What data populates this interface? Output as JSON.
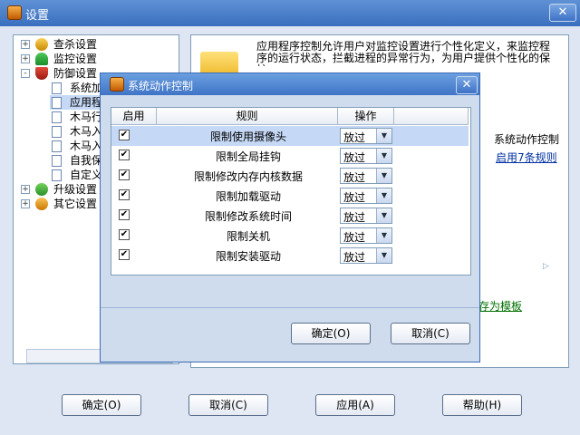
{
  "main": {
    "title": "设置",
    "close_label": "✕",
    "description": "应用程序控制允许用户对监控设置进行个性化定义，来监控程序的运行状态，拦截进程的异常行为，为用户提供个性化的保护。",
    "table_col_header": "系统动作控制",
    "table_cell": "启用7条规则",
    "template_link": "存为模板",
    "buttons": {
      "ok": "确定(O)",
      "cancel": "取消(C)",
      "apply": "应用(A)",
      "help": "帮助(H)"
    }
  },
  "tree": {
    "items": [
      {
        "label": "查杀设置",
        "expander": "+",
        "icon": "scan-icon"
      },
      {
        "label": "监控设置",
        "expander": "+",
        "icon": "umbrella-icon"
      },
      {
        "label": "防御设置",
        "expander": "-",
        "icon": "shield-icon"
      },
      {
        "label": "系统加",
        "icon": "page-icon"
      },
      {
        "label": "应用程",
        "icon": "page-icon",
        "selected": true
      },
      {
        "label": "木马行",
        "icon": "page-icon"
      },
      {
        "label": "木马入",
        "icon": "page-icon"
      },
      {
        "label": "木马入",
        "icon": "page-icon"
      },
      {
        "label": "自我保",
        "icon": "page-icon"
      },
      {
        "label": "自定义",
        "icon": "page-icon"
      },
      {
        "label": "升级设置",
        "expander": "+",
        "icon": "update-icon"
      },
      {
        "label": "其它设置",
        "expander": "+",
        "icon": "gear-icon"
      }
    ]
  },
  "dialog": {
    "title": "系统动作控制",
    "close_label": "✕",
    "headers": {
      "enable": "启用",
      "rule": "规则",
      "action": "操作"
    },
    "rows": [
      {
        "enabled": true,
        "rule": "限制使用摄像头",
        "action": "放过"
      },
      {
        "enabled": true,
        "rule": "限制全局挂钩",
        "action": "放过"
      },
      {
        "enabled": true,
        "rule": "限制修改内存内核数据",
        "action": "放过"
      },
      {
        "enabled": true,
        "rule": "限制加载驱动",
        "action": "放过"
      },
      {
        "enabled": true,
        "rule": "限制修改系统时间",
        "action": "放过"
      },
      {
        "enabled": true,
        "rule": "限制关机",
        "action": "放过"
      },
      {
        "enabled": true,
        "rule": "限制安装驱动",
        "action": "放过"
      }
    ],
    "ok": "确定(O)",
    "cancel": "取消(C)",
    "check_mark": "✔",
    "dropdown_arrow": "▼"
  },
  "colors": {
    "title_bar": "#3a6fbf",
    "selected_row": "#c5d8f5"
  }
}
